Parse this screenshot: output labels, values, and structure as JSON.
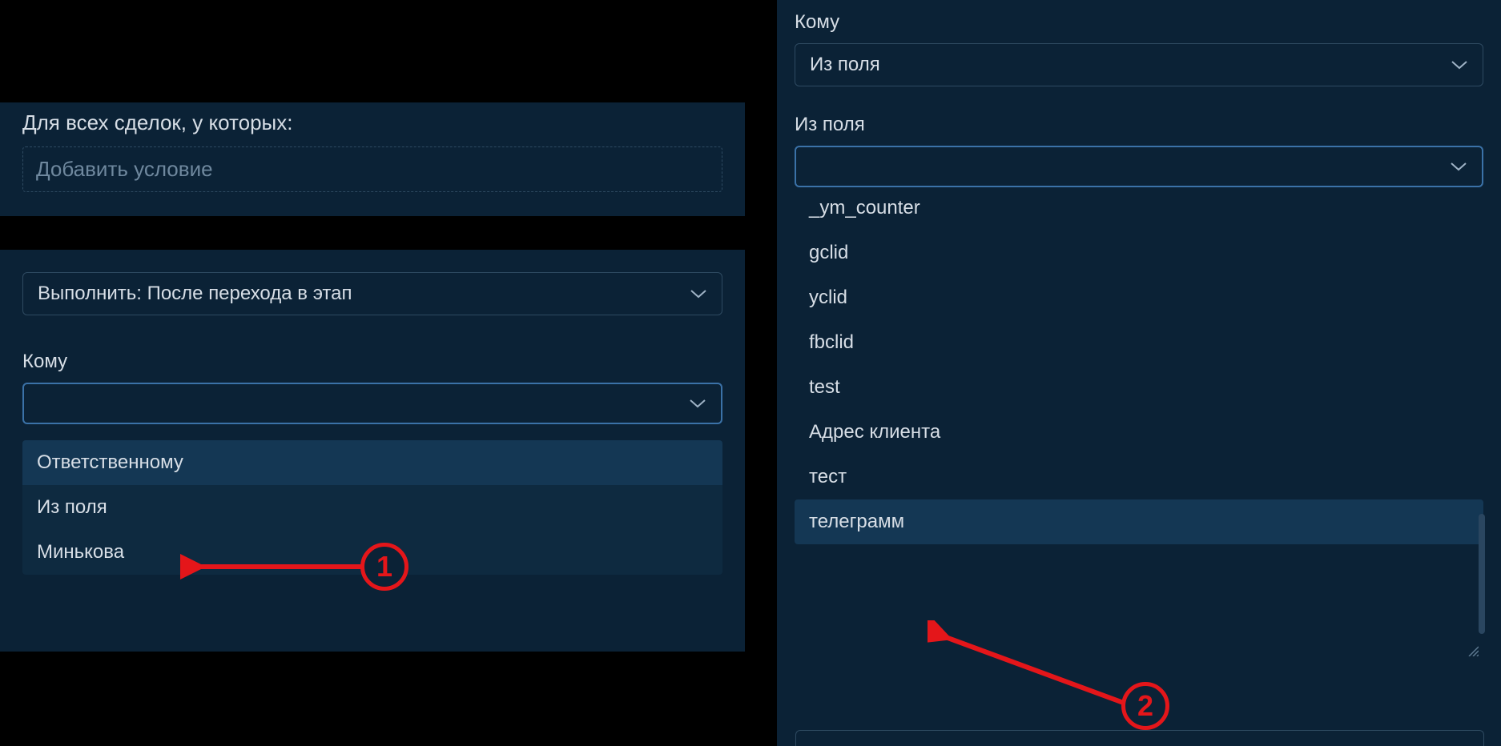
{
  "left": {
    "conditions_label": "Для всех сделок, у которых:",
    "add_condition_placeholder": "Добавить условие",
    "execute_select": "Выполнить: После перехода в этап",
    "to_label": "Кому",
    "to_options": [
      "Ответственному",
      "Из поля",
      "Минькова"
    ]
  },
  "right": {
    "to_label": "Кому",
    "to_select_value": "Из поля",
    "from_field_label": "Из поля",
    "field_options_partial_top": "_ym_counter",
    "field_options": [
      "gclid",
      "yclid",
      "fbclid",
      "test",
      "Адрес клиента",
      "тест",
      "телеграмм"
    ],
    "highlighted_index": 6
  },
  "annotations": {
    "one": "1",
    "two": "2"
  }
}
